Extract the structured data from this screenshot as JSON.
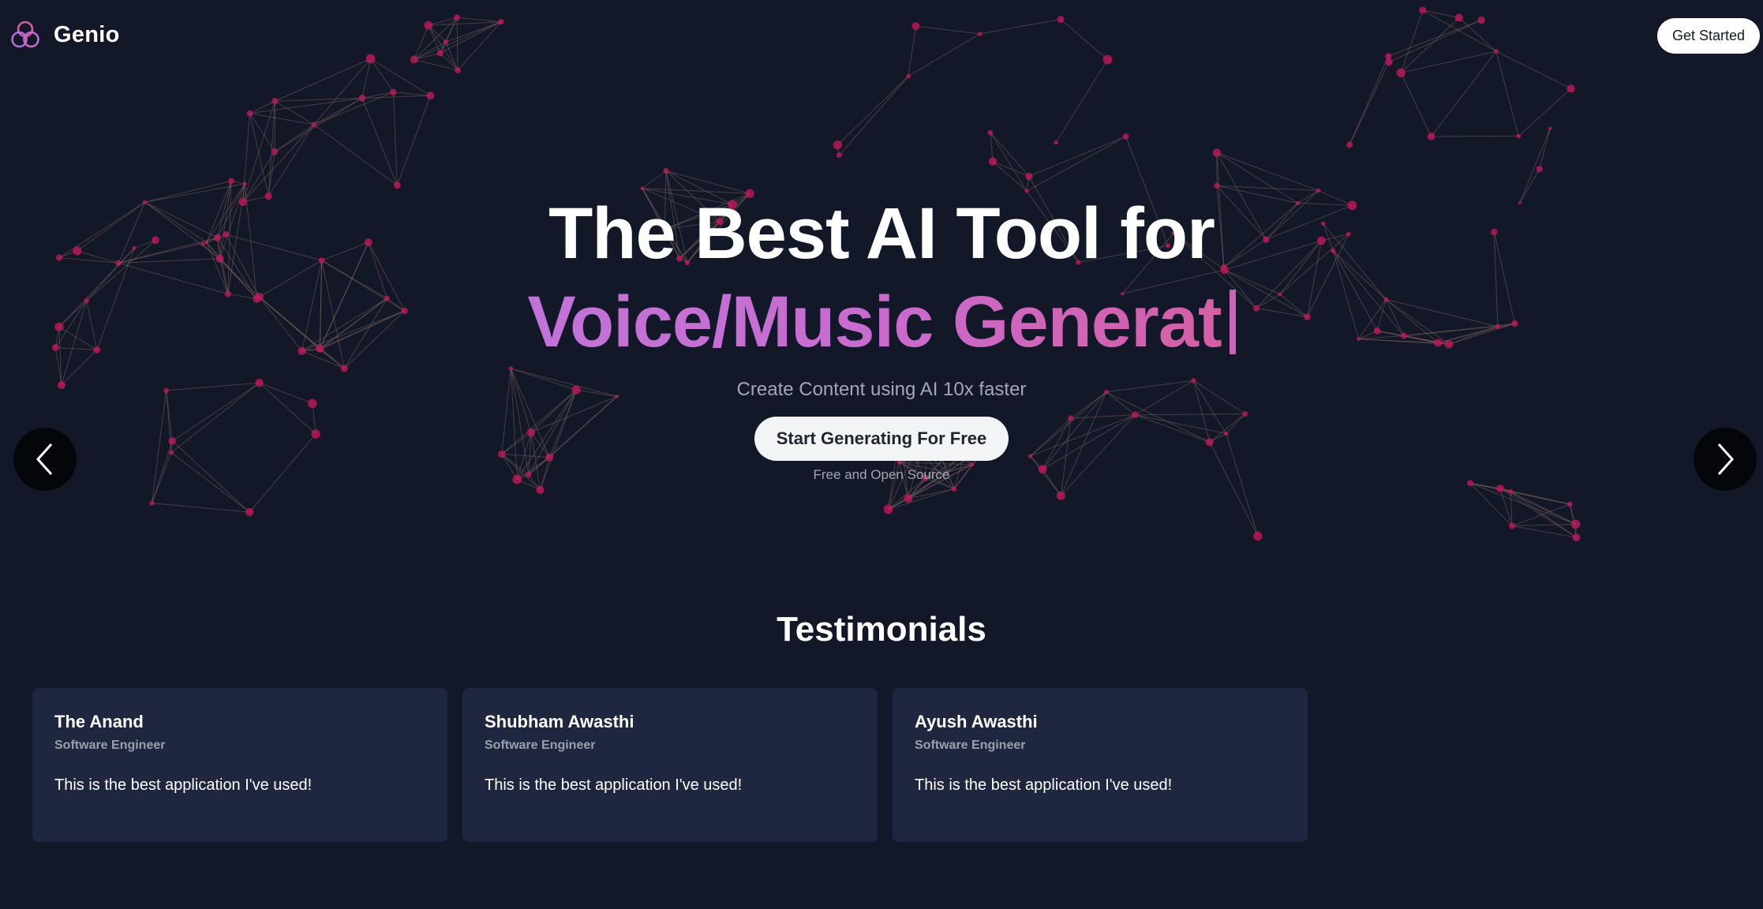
{
  "header": {
    "brand": "Genio",
    "get_started_label": "Get Started"
  },
  "hero": {
    "title_line1": "The Best AI Tool for",
    "title_line2": "Voice/Music Generat",
    "subtitle": "Create Content using AI 10x faster",
    "cta_label": "Start Generating For Free",
    "cta_note": "Free and Open Source"
  },
  "testimonials": {
    "title": "Testimonials",
    "items": [
      {
        "name": "The Anand",
        "role": "Software Engineer",
        "quote": "This is the best application I've used!"
      },
      {
        "name": "Shubham Awasthi",
        "role": "Software Engineer",
        "quote": "This is the best application I've used!"
      },
      {
        "name": "Ayush Awasthi",
        "role": "Software Engineer",
        "quote": "This is the best application I've used!"
      }
    ]
  },
  "colors": {
    "background": "#131829",
    "card": "#1f2640",
    "accent_start": "#c273d8",
    "accent_end": "#d65fa4",
    "node": "#c2185b"
  },
  "icons": {
    "logo": "three-rings-logo-icon",
    "prev": "chevron-left-icon",
    "next": "chevron-right-icon"
  }
}
